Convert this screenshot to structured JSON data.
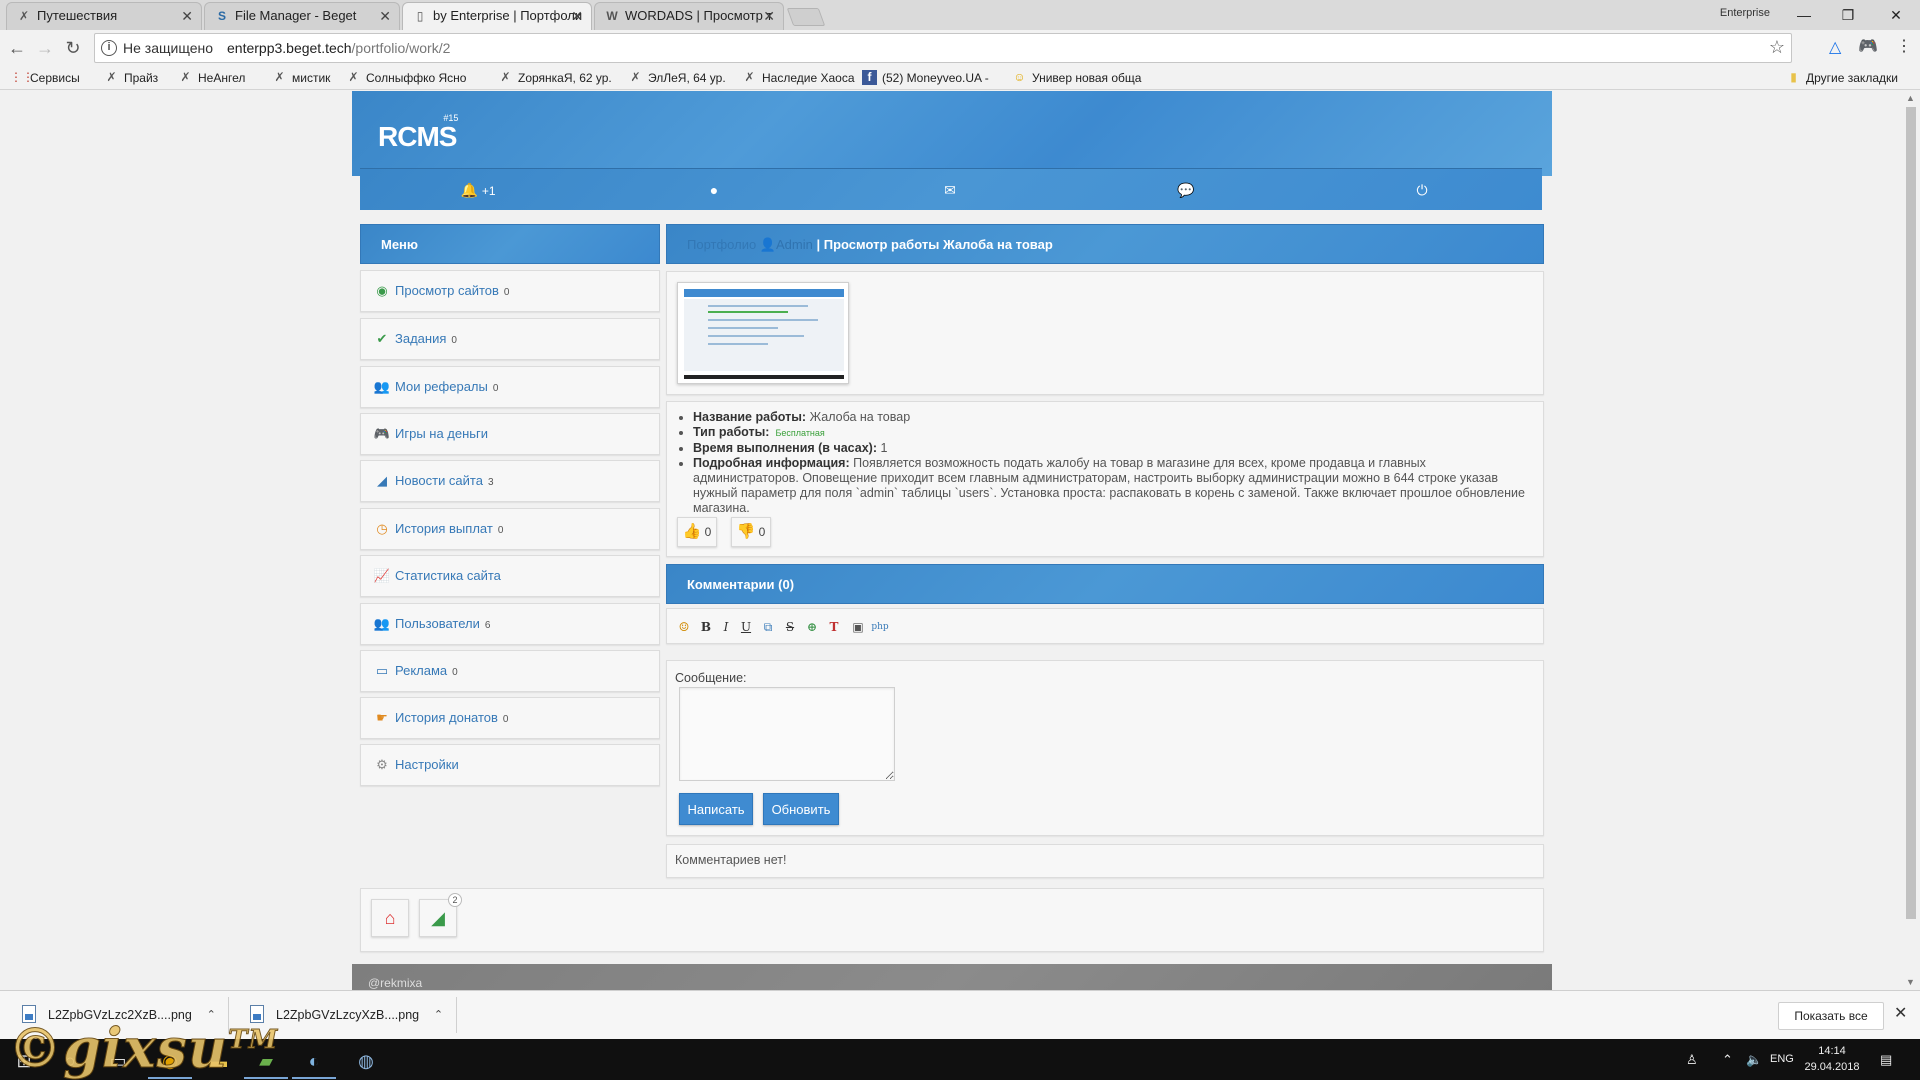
{
  "browser": {
    "tabs": [
      {
        "title": "Путешествия",
        "icon": "x-favicon-icon"
      },
      {
        "title": "File Manager - Beget",
        "icon": "s-favicon-icon"
      },
      {
        "title": "by Enterprise | Портфоли",
        "icon": "page-favicon-icon"
      },
      {
        "title": "WORDADS | Просмотр т",
        "icon": "w-favicon-icon"
      }
    ],
    "profile": "Enterprise",
    "security": "Не защищено",
    "url_host": "enterpp3.beget.tech",
    "url_path": "/portfolio/work/2",
    "bookmarks": [
      "Сервисы",
      "Прайз",
      "НеАнгел",
      "мистик",
      "Солныффко Ясно",
      "ZорянкаЯ, 62 ур.",
      "ЭлЛеЯ, 64 ур.",
      "Наследие Хаоса",
      "(52) Moneyveo.UA -",
      "Универ новая обща"
    ],
    "other_bookmarks": "Другие закладки"
  },
  "site": {
    "logo": "RCMS",
    "logo_sup": "#15",
    "topnav": {
      "notifications_count": "+1"
    },
    "menu_title": "Меню",
    "menu": [
      {
        "label": "Просмотр сайтов",
        "count": "0",
        "icon": "eye-icon",
        "color": "#3a9a4a"
      },
      {
        "label": "Задания",
        "count": "0",
        "icon": "check-icon",
        "color": "#3a9a4a"
      },
      {
        "label": "Мои рефералы",
        "count": "0",
        "icon": "users-icon",
        "color": "#3779b7"
      },
      {
        "label": "Игры на деньги",
        "count": "",
        "icon": "gamepad-icon",
        "color": "#3779b7"
      },
      {
        "label": "Новости сайта",
        "count": "3",
        "icon": "rss-icon",
        "color": "#3779b7"
      },
      {
        "label": "История выплат",
        "count": "0",
        "icon": "history-icon",
        "color": "#e08a20"
      },
      {
        "label": "Статистика сайта",
        "count": "",
        "icon": "stats-icon",
        "color": "#c03030"
      },
      {
        "label": "Пользователи",
        "count": "6",
        "icon": "people-icon",
        "color": "#888888"
      },
      {
        "label": "Реклама",
        "count": "0",
        "icon": "monitor-icon",
        "color": "#3779b7"
      },
      {
        "label": "История донатов",
        "count": "0",
        "icon": "donate-icon",
        "color": "#e08a20"
      },
      {
        "label": "Настройки",
        "count": "",
        "icon": "gear-icon",
        "color": "#888888"
      }
    ],
    "content_head": {
      "crumb": "Портфолио",
      "user": "Admin",
      "title_prefix": "| Просмотр работы",
      "title_work": "Жалоба на товар"
    },
    "work": {
      "name_label": "Название работы:",
      "name": "Жалоба на товар",
      "type_label": "Тип работы:",
      "type": "Бесплатная",
      "time_label": "Время выполнения (в часах):",
      "time": "1",
      "details_label": "Подробная информация:",
      "details": "Появляется возможность подать жалобу на товар в магазине для всех, кроме продавца и главных администраторов. Оповещение приходит всем главным администраторам, настроить выборку администрации можно в 644 строке указав нужный параметр для поля `admin` таблицы `users`. Установка проста: распаковать в корень с заменой. Также включает прошлое обновление магазина.",
      "likes": "0",
      "dislikes": "0"
    },
    "comments": {
      "title": "Комментарии (0)",
      "message_label": "Сообщение:",
      "submit": "Написать",
      "refresh": "Обновить",
      "empty": "Комментариев нет!"
    },
    "footer_badge": "2",
    "footer_text": "@rekmixa"
  },
  "downloads": {
    "files": [
      "L2ZpbGVzLzc2XzB....png",
      "L2ZpbGVzLzcyXzB....png"
    ],
    "show_all": "Показать все"
  },
  "taskbar": {
    "lang": "ENG",
    "time": "14:14",
    "date": "29.04.2018"
  },
  "watermark": {
    "text": "©gixsu",
    "tm": "TM"
  }
}
